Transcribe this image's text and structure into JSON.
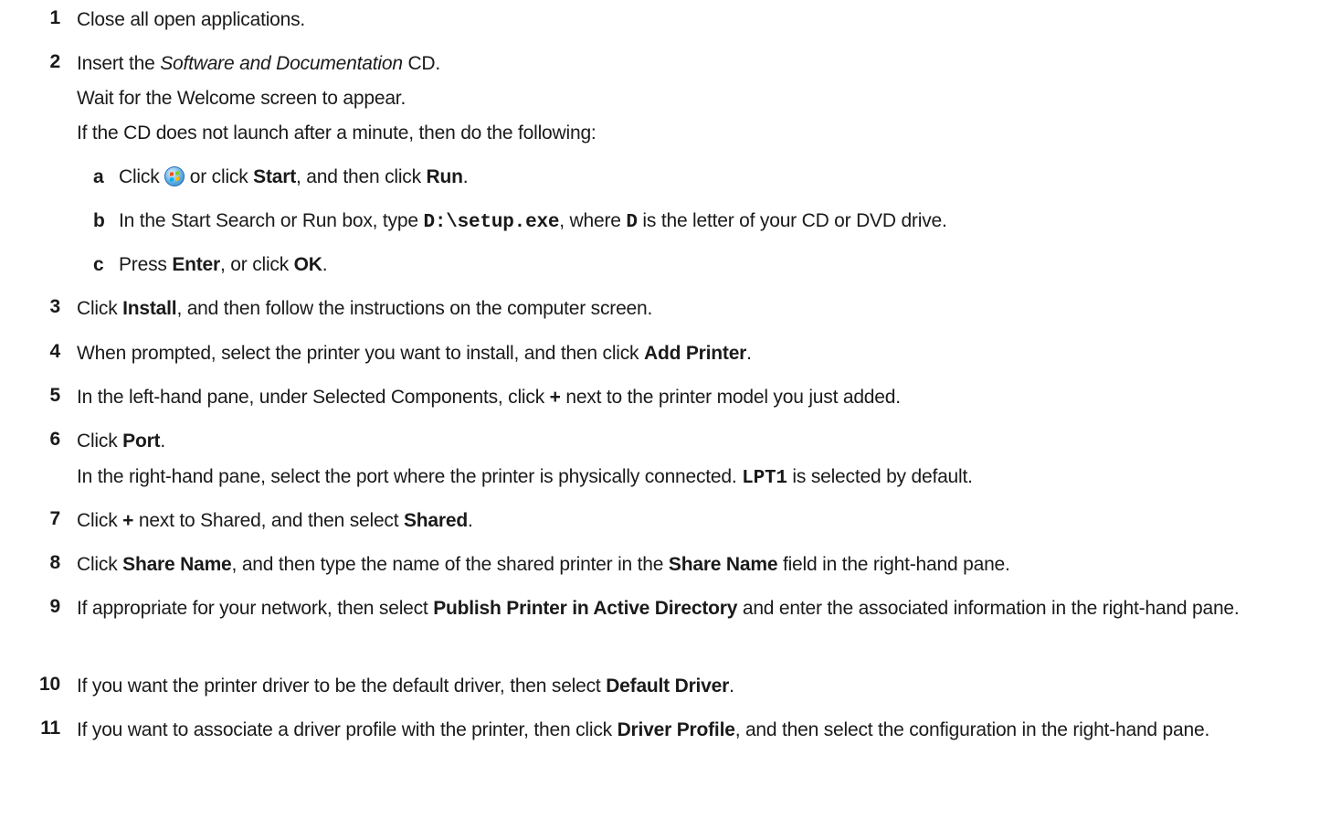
{
  "steps": [
    {
      "num": "1",
      "parts": [
        "Close all open applications."
      ]
    },
    {
      "num": "2",
      "parts": [
        "Insert the ",
        "Software and Documentation",
        " CD."
      ]
    },
    {
      "num": "3",
      "parts": [
        "Click ",
        "Install",
        ", and then follow the instructions on the computer screen."
      ]
    },
    {
      "num": "4",
      "parts": [
        "When prompted, select the printer you want to install, and then click ",
        "Add Printer",
        "."
      ]
    },
    {
      "num": "5",
      "parts": [
        "In the left-hand pane, under Selected Components, click ",
        "+",
        " next to the printer model you just added."
      ]
    },
    {
      "num": "6",
      "parts": [
        "Click ",
        "Port",
        "."
      ]
    },
    {
      "num": "7",
      "parts": [
        "Click ",
        "+",
        " next to Shared, and then select ",
        "Shared",
        "."
      ]
    },
    {
      "num": "8",
      "parts": [
        "Click ",
        "Share Name",
        ", and then type the name of the shared printer in the ",
        "Share Name",
        " field in the right-hand pane."
      ]
    },
    {
      "num": "9",
      "parts": [
        "If appropriate for your network, then select ",
        "Publish Printer in Active Directory",
        " and enter the associated information in the right-hand pane."
      ]
    },
    {
      "num": "10",
      "parts": [
        "If you want the printer driver to be the default driver, then select ",
        "Default Driver",
        "."
      ]
    },
    {
      "num": "11",
      "parts": [
        "If you want to associate a driver profile with the printer, then click ",
        "Driver Profile",
        ", and then select the configuration in the right-hand pane."
      ]
    }
  ],
  "step2_notes": [
    "Wait for the Welcome screen to appear.",
    "If the CD does not launch after a minute, then do the following:"
  ],
  "substeps": [
    {
      "letter": "a",
      "parts": [
        "Click ",
        " or click ",
        "Start",
        ", and then click ",
        "Run",
        "."
      ]
    },
    {
      "letter": "b",
      "parts": [
        "In the Start Search or Run box, type ",
        "D:\\setup.exe",
        ", where ",
        "D",
        " is the letter of your CD or DVD drive."
      ]
    },
    {
      "letter": "c",
      "parts": [
        "Press ",
        "Enter",
        ", or click ",
        "OK",
        "."
      ]
    }
  ],
  "step6_note": [
    "In the right-hand pane, select the port where the printer is physically connected. ",
    "LPT1",
    " is selected by default."
  ],
  "icons": {
    "start_button": "windows-start-orb-icon"
  }
}
